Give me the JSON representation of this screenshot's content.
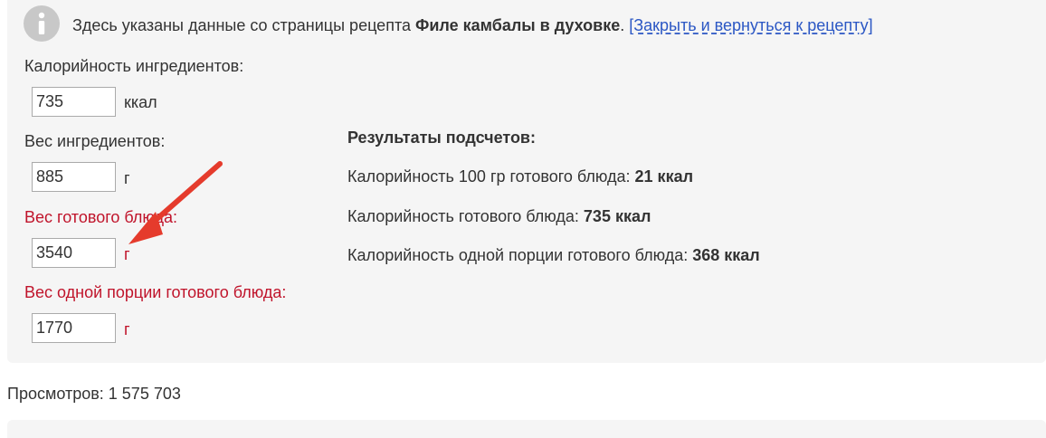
{
  "info": {
    "icon": "info-icon",
    "text_before": "Здесь указаны данные со страницы рецепта ",
    "recipe_name": "Филе камбалы в духовке",
    "separator": ". ",
    "link_label": "[Закрыть и вернуться к рецепту]"
  },
  "fields": [
    {
      "label": "Калорийность ингредиентов:",
      "value": "735",
      "unit": "ккал"
    },
    {
      "label": "Вес ингредиентов:",
      "value": "885",
      "unit": "г"
    },
    {
      "label": "Вес готового блюда:",
      "value": "3540",
      "unit": "г"
    },
    {
      "label": "Вес одной порции готового блюда:",
      "value": "1770",
      "unit": "г"
    }
  ],
  "results": {
    "title": "Результаты подсчетов:",
    "lines": [
      {
        "label": "Калорийность 100 гр готового блюда: ",
        "value": "21 ккал"
      },
      {
        "label": "Калорийность готового блюда: ",
        "value": "735 ккал"
      },
      {
        "label": "Калорийность одной порции готового блюда: ",
        "value": "368 ккал"
      }
    ]
  },
  "views": "Просмотров: 1 575 703",
  "colors": {
    "panel_bg": "#f5f5f5",
    "highlight_red": "#c0142b",
    "link_blue": "#2b57c4",
    "arrow_red": "#e53b2c"
  }
}
